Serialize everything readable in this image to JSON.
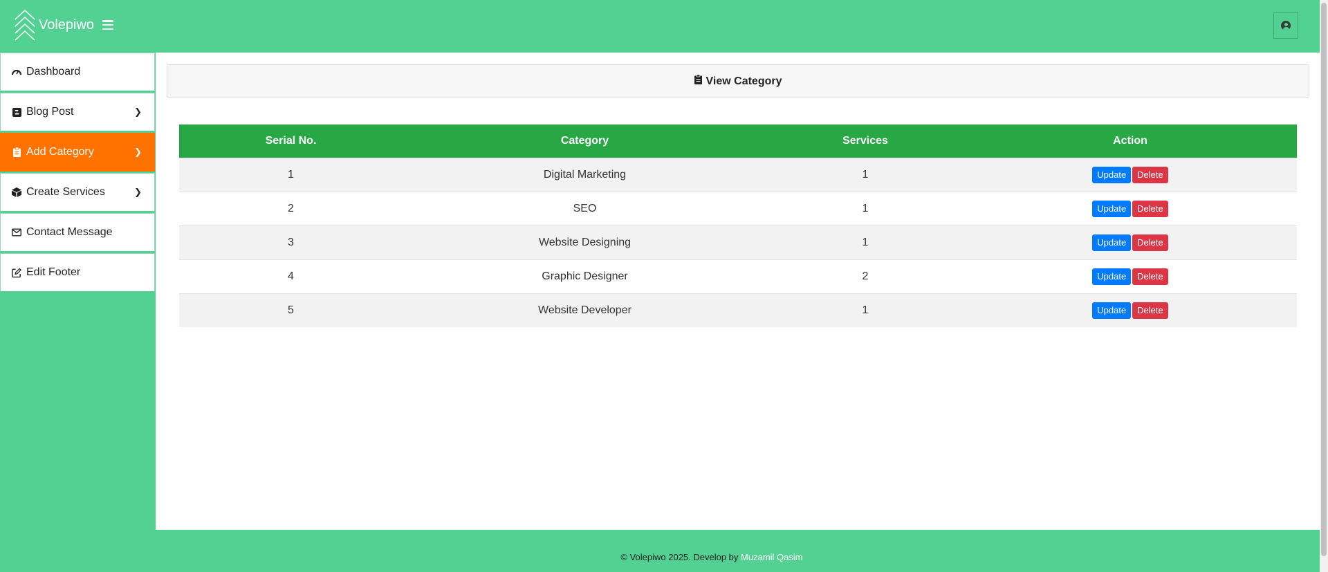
{
  "header": {
    "brand": "Volepiwo"
  },
  "sidebar": {
    "items": [
      {
        "label": "Dashboard",
        "icon": "dashboard-icon",
        "chevron": false,
        "active": false
      },
      {
        "label": "Blog Post",
        "icon": "blogger-icon",
        "chevron": true,
        "active": false
      },
      {
        "label": "Add Category",
        "icon": "clipboard-icon",
        "chevron": true,
        "active": true
      },
      {
        "label": "Create Services",
        "icon": "cube-icon",
        "chevron": true,
        "active": false
      },
      {
        "label": "Contact Message",
        "icon": "envelope-icon",
        "chevron": false,
        "active": false
      },
      {
        "label": "Edit Footer",
        "icon": "edit-icon",
        "chevron": false,
        "active": false
      }
    ]
  },
  "main": {
    "title": "View Category",
    "table": {
      "headers": [
        "Serial No.",
        "Category",
        "Services",
        "Action"
      ],
      "rows": [
        {
          "serial": "1",
          "category": "Digital Marketing",
          "services": "1"
        },
        {
          "serial": "2",
          "category": "SEO",
          "services": "1"
        },
        {
          "serial": "3",
          "category": "Website Designing",
          "services": "1"
        },
        {
          "serial": "4",
          "category": "Graphic Designer",
          "services": "2"
        },
        {
          "serial": "5",
          "category": "Website Developer",
          "services": "1"
        }
      ],
      "update_label": "Update",
      "delete_label": "Delete"
    }
  },
  "footer": {
    "text": "© Volepiwo 2025. Develop by ",
    "author": "Muzamil Qasim"
  },
  "colors": {
    "green": "#52d193",
    "table_header": "#28a745",
    "active": "#ff7200",
    "update": "#007bff",
    "delete": "#dc3545"
  }
}
